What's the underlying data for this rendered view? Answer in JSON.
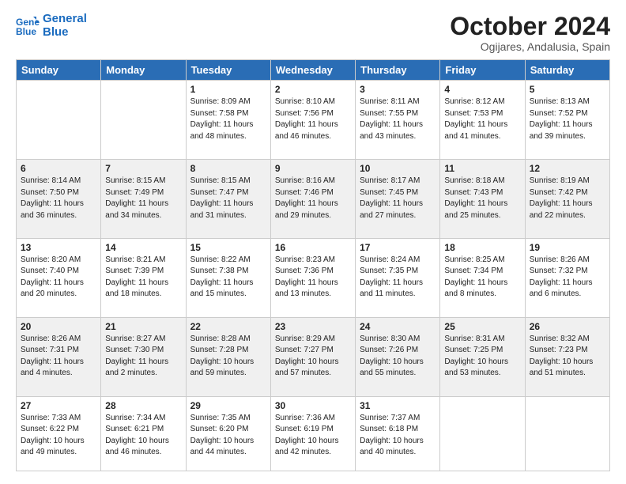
{
  "logo": {
    "line1": "General",
    "line2": "Blue"
  },
  "header": {
    "month": "October 2024",
    "location": "Ogijares, Andalusia, Spain"
  },
  "weekdays": [
    "Sunday",
    "Monday",
    "Tuesday",
    "Wednesday",
    "Thursday",
    "Friday",
    "Saturday"
  ],
  "weeks": [
    [
      {
        "day": "",
        "info": ""
      },
      {
        "day": "",
        "info": ""
      },
      {
        "day": "1",
        "info": "Sunrise: 8:09 AM\nSunset: 7:58 PM\nDaylight: 11 hours and 48 minutes."
      },
      {
        "day": "2",
        "info": "Sunrise: 8:10 AM\nSunset: 7:56 PM\nDaylight: 11 hours and 46 minutes."
      },
      {
        "day": "3",
        "info": "Sunrise: 8:11 AM\nSunset: 7:55 PM\nDaylight: 11 hours and 43 minutes."
      },
      {
        "day": "4",
        "info": "Sunrise: 8:12 AM\nSunset: 7:53 PM\nDaylight: 11 hours and 41 minutes."
      },
      {
        "day": "5",
        "info": "Sunrise: 8:13 AM\nSunset: 7:52 PM\nDaylight: 11 hours and 39 minutes."
      }
    ],
    [
      {
        "day": "6",
        "info": "Sunrise: 8:14 AM\nSunset: 7:50 PM\nDaylight: 11 hours and 36 minutes."
      },
      {
        "day": "7",
        "info": "Sunrise: 8:15 AM\nSunset: 7:49 PM\nDaylight: 11 hours and 34 minutes."
      },
      {
        "day": "8",
        "info": "Sunrise: 8:15 AM\nSunset: 7:47 PM\nDaylight: 11 hours and 31 minutes."
      },
      {
        "day": "9",
        "info": "Sunrise: 8:16 AM\nSunset: 7:46 PM\nDaylight: 11 hours and 29 minutes."
      },
      {
        "day": "10",
        "info": "Sunrise: 8:17 AM\nSunset: 7:45 PM\nDaylight: 11 hours and 27 minutes."
      },
      {
        "day": "11",
        "info": "Sunrise: 8:18 AM\nSunset: 7:43 PM\nDaylight: 11 hours and 25 minutes."
      },
      {
        "day": "12",
        "info": "Sunrise: 8:19 AM\nSunset: 7:42 PM\nDaylight: 11 hours and 22 minutes."
      }
    ],
    [
      {
        "day": "13",
        "info": "Sunrise: 8:20 AM\nSunset: 7:40 PM\nDaylight: 11 hours and 20 minutes."
      },
      {
        "day": "14",
        "info": "Sunrise: 8:21 AM\nSunset: 7:39 PM\nDaylight: 11 hours and 18 minutes."
      },
      {
        "day": "15",
        "info": "Sunrise: 8:22 AM\nSunset: 7:38 PM\nDaylight: 11 hours and 15 minutes."
      },
      {
        "day": "16",
        "info": "Sunrise: 8:23 AM\nSunset: 7:36 PM\nDaylight: 11 hours and 13 minutes."
      },
      {
        "day": "17",
        "info": "Sunrise: 8:24 AM\nSunset: 7:35 PM\nDaylight: 11 hours and 11 minutes."
      },
      {
        "day": "18",
        "info": "Sunrise: 8:25 AM\nSunset: 7:34 PM\nDaylight: 11 hours and 8 minutes."
      },
      {
        "day": "19",
        "info": "Sunrise: 8:26 AM\nSunset: 7:32 PM\nDaylight: 11 hours and 6 minutes."
      }
    ],
    [
      {
        "day": "20",
        "info": "Sunrise: 8:26 AM\nSunset: 7:31 PM\nDaylight: 11 hours and 4 minutes."
      },
      {
        "day": "21",
        "info": "Sunrise: 8:27 AM\nSunset: 7:30 PM\nDaylight: 11 hours and 2 minutes."
      },
      {
        "day": "22",
        "info": "Sunrise: 8:28 AM\nSunset: 7:28 PM\nDaylight: 10 hours and 59 minutes."
      },
      {
        "day": "23",
        "info": "Sunrise: 8:29 AM\nSunset: 7:27 PM\nDaylight: 10 hours and 57 minutes."
      },
      {
        "day": "24",
        "info": "Sunrise: 8:30 AM\nSunset: 7:26 PM\nDaylight: 10 hours and 55 minutes."
      },
      {
        "day": "25",
        "info": "Sunrise: 8:31 AM\nSunset: 7:25 PM\nDaylight: 10 hours and 53 minutes."
      },
      {
        "day": "26",
        "info": "Sunrise: 8:32 AM\nSunset: 7:23 PM\nDaylight: 10 hours and 51 minutes."
      }
    ],
    [
      {
        "day": "27",
        "info": "Sunrise: 7:33 AM\nSunset: 6:22 PM\nDaylight: 10 hours and 49 minutes."
      },
      {
        "day": "28",
        "info": "Sunrise: 7:34 AM\nSunset: 6:21 PM\nDaylight: 10 hours and 46 minutes."
      },
      {
        "day": "29",
        "info": "Sunrise: 7:35 AM\nSunset: 6:20 PM\nDaylight: 10 hours and 44 minutes."
      },
      {
        "day": "30",
        "info": "Sunrise: 7:36 AM\nSunset: 6:19 PM\nDaylight: 10 hours and 42 minutes."
      },
      {
        "day": "31",
        "info": "Sunrise: 7:37 AM\nSunset: 6:18 PM\nDaylight: 10 hours and 40 minutes."
      },
      {
        "day": "",
        "info": ""
      },
      {
        "day": "",
        "info": ""
      }
    ]
  ]
}
